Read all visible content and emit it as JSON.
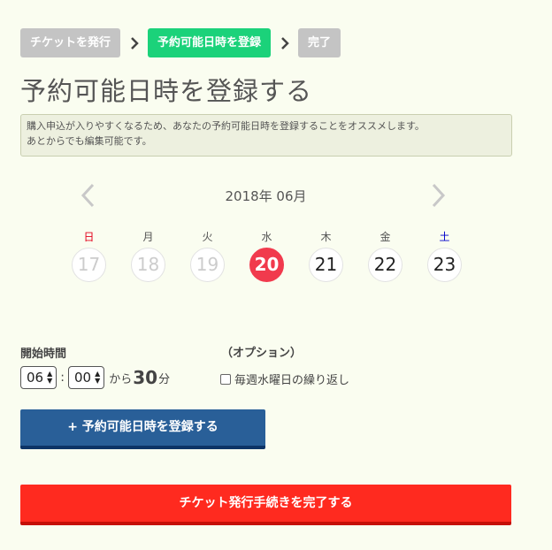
{
  "steps": [
    {
      "label": "チケットを発行",
      "state": "inactive"
    },
    {
      "label": "予約可能日時を登録",
      "state": "active"
    },
    {
      "label": "完了",
      "state": "inactive"
    }
  ],
  "page_title": "予約可能日時を登録する",
  "notice": {
    "line1": "購入申込が入りやすくなるため、あなたの予約可能日時を登録することをオススメします。",
    "line2": "あとからでも編集可能です。"
  },
  "calendar": {
    "month_label": "2018年 06月",
    "prev_icon": "chevron-left-icon",
    "next_icon": "chevron-right-icon",
    "weekdays": [
      "日",
      "月",
      "火",
      "水",
      "木",
      "金",
      "土"
    ],
    "days": [
      "17",
      "18",
      "19",
      "20",
      "21",
      "22",
      "23"
    ],
    "selected_day": "20",
    "colors": {
      "sunday": "#e3001b",
      "saturday": "#0000cc",
      "selected": "#f13a4d"
    }
  },
  "time": {
    "start_label": "開始時間",
    "hour": "06",
    "minute": "00",
    "colon": ":",
    "from_text": "から",
    "duration": "30",
    "duration_unit": "分"
  },
  "option": {
    "label": "（オプション）",
    "repeat_label": "毎週水曜日の繰り返し",
    "repeat_checked": false
  },
  "buttons": {
    "register": "+ 予約可能日時を登録する",
    "complete": "チケット発行手続きを完了する"
  },
  "colors": {
    "background": "#fafdf0",
    "step_active": "#1bd27a",
    "step_inactive": "#c4c4c4",
    "register_button": "#295f98",
    "complete_button": "#ff2a1f"
  }
}
